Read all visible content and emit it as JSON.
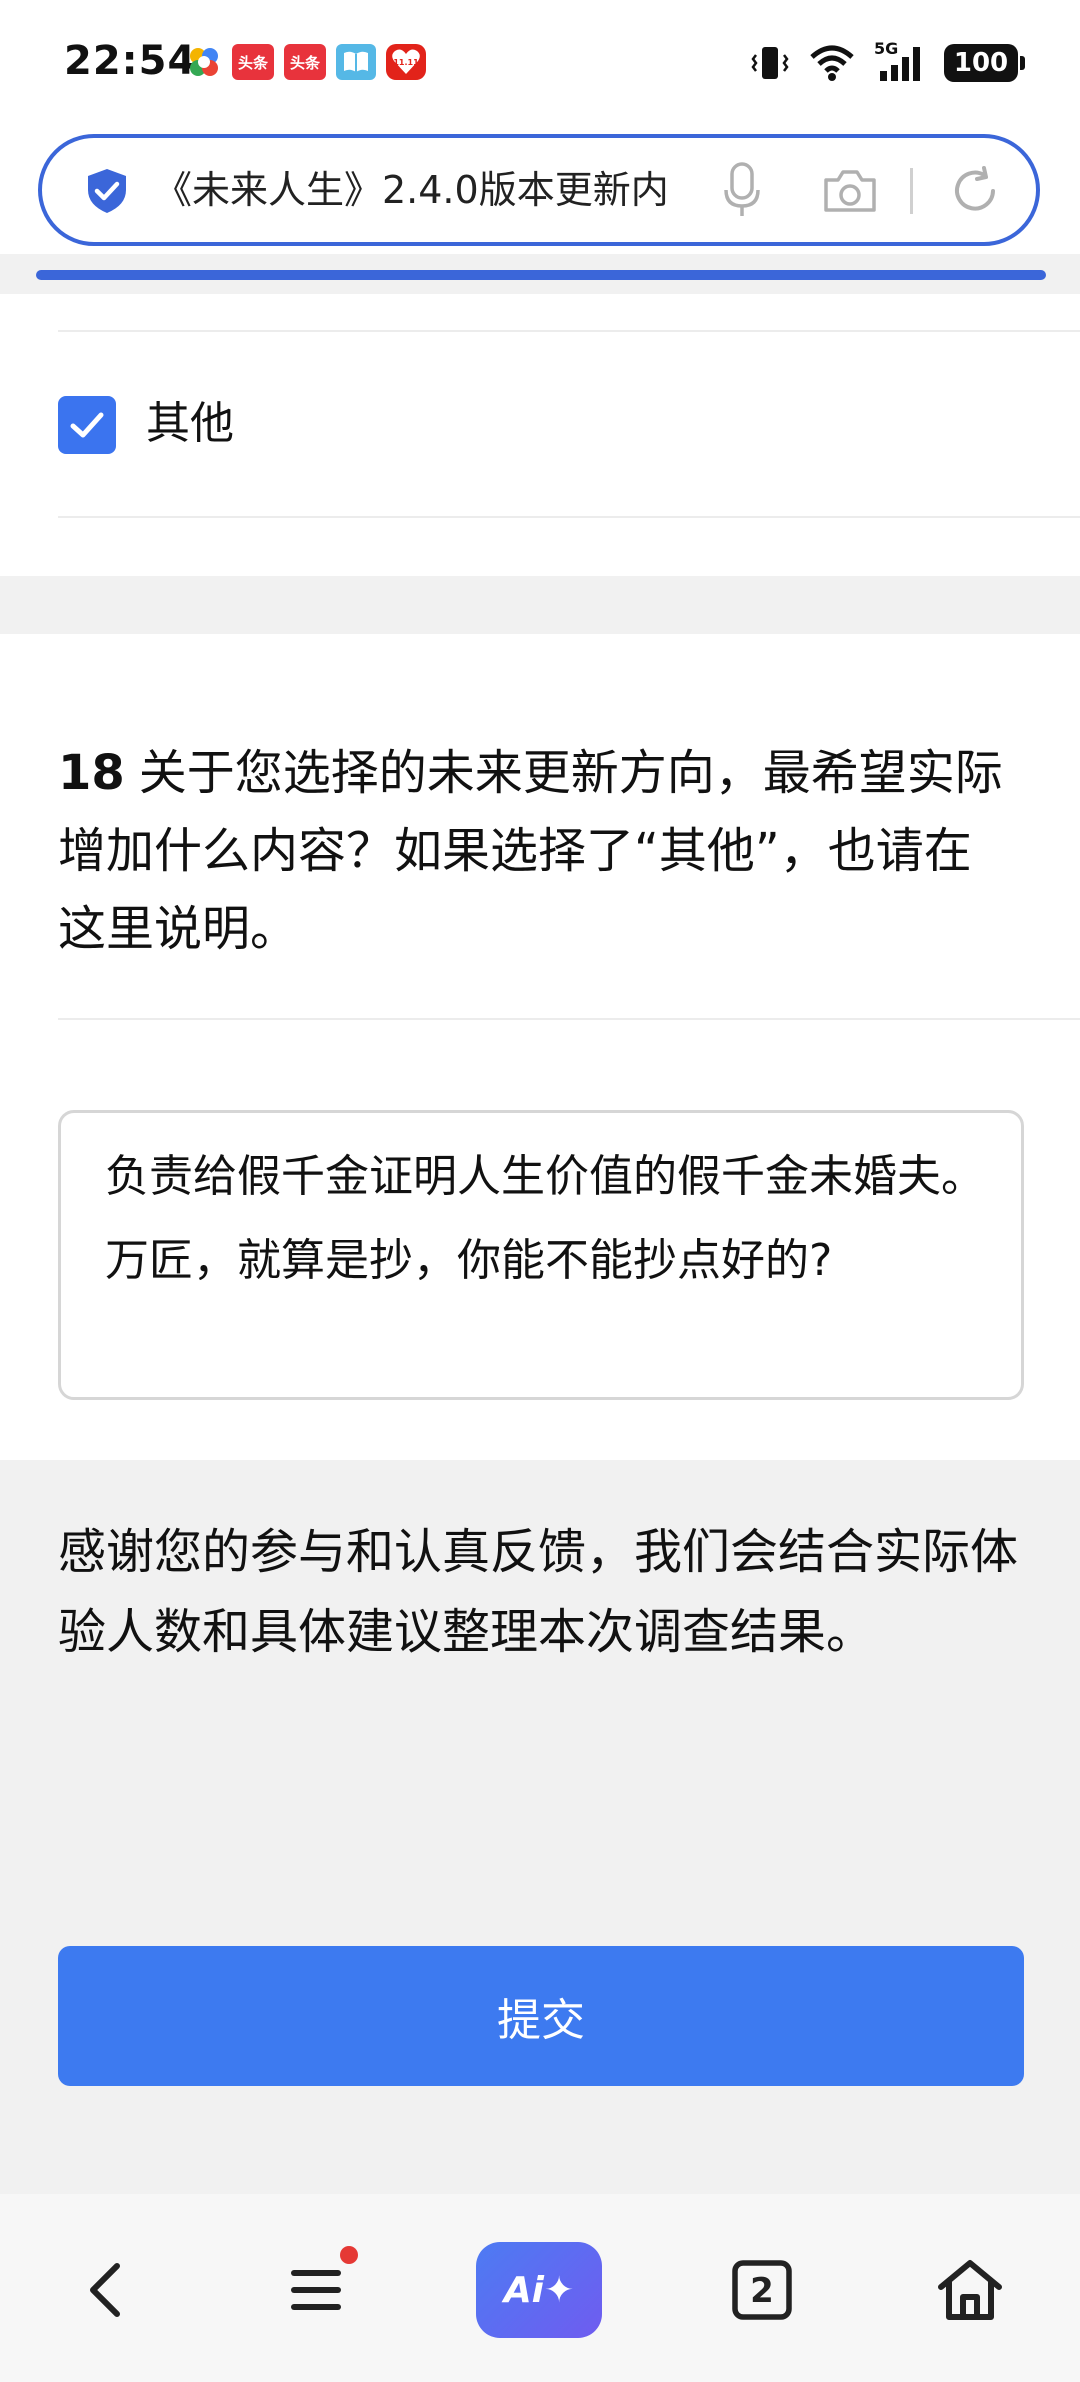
{
  "status_bar": {
    "time": "22:54",
    "notifications": {
      "toutiao_1": "头条",
      "toutiao_2": "头条",
      "tmall": "11.11"
    },
    "network": "5G",
    "battery": "100"
  },
  "address_bar": {
    "url_text": "《未来人生》2.4.0版本更新内"
  },
  "option": {
    "label": "其他",
    "checked": true
  },
  "question": {
    "number": "18",
    "text": "关于您选择的未来更新方向，最希望实际增加什么内容？如果选择了“其他”，也请在这里说明。",
    "answer": "负责给假千金证明人生价值的假千金未婚夫。万匠，就算是抄，你能不能抄点好的?"
  },
  "thanks_text": "感谢您的参与和认真反馈，我们会结合实际体验人数和具体建议整理本次调查结果。",
  "submit_label": "提交",
  "bottom_nav": {
    "ai_label": "Ai✦",
    "tab_count": "2"
  },
  "colors": {
    "accent": "#3d7af0",
    "checkbox": "#3b74ef",
    "address_border": "#3b66d9"
  }
}
